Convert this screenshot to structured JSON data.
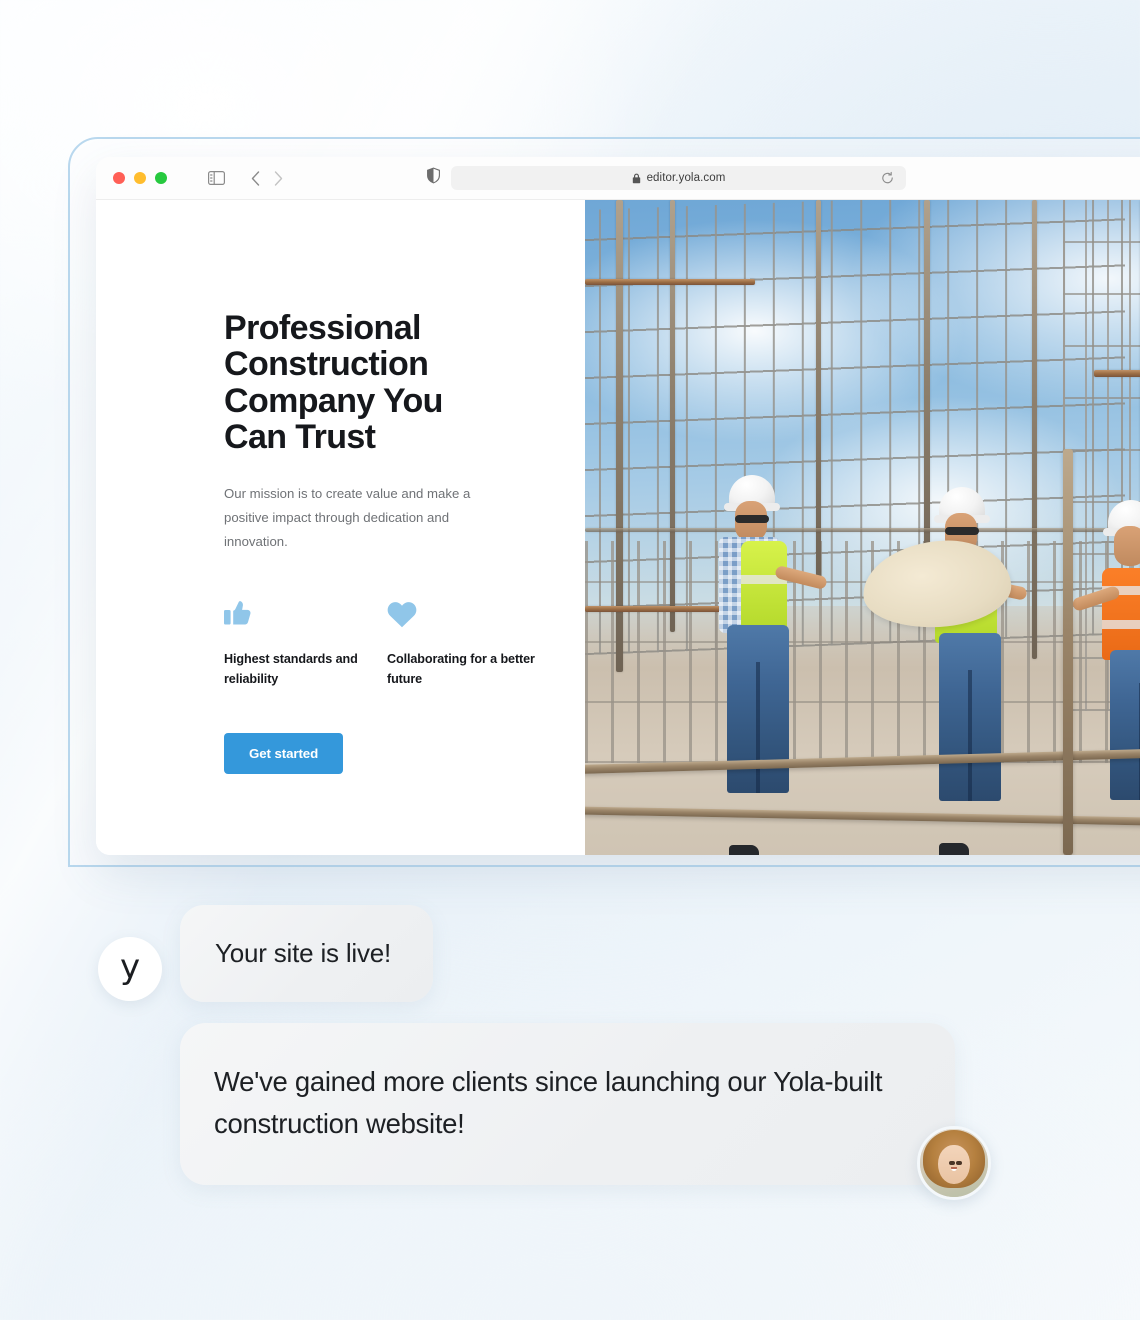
{
  "browser": {
    "traffic_lights": [
      "close",
      "minimize",
      "maximize"
    ],
    "sidebar_icon": "sidebar-toggle-icon",
    "back_icon": "chevron-left-icon",
    "forward_icon": "chevron-right-icon",
    "shield_icon": "privacy-shield-icon",
    "lock_icon": "lock-icon",
    "url": "editor.yola.com",
    "reload_icon": "reload-icon"
  },
  "site": {
    "hero_title": "Professional Construction Company You Can Trust",
    "hero_subtitle": "Our mission is to create value and make a positive impact through dedication and innovation.",
    "features": [
      {
        "icon": "thumbs-up-icon",
        "label": "Highest standards and reliability"
      },
      {
        "icon": "heart-icon",
        "label": "Collaborating for a better future"
      }
    ],
    "cta_label": "Get started",
    "photo_alt": "Three construction workers in hard hats and hi-vis vests reviewing plans at a rebar construction site"
  },
  "chat": {
    "brand_initial": "y",
    "message_1": "Your site is live!",
    "message_2": "We've gained more clients since launching our Yola-built construction website!",
    "avatar_alt": "Smiling woman portrait"
  },
  "colors": {
    "cta_blue": "#3498db",
    "feature_icon_blue": "#90c6e9",
    "frame_border": "#b9d8ee",
    "heading_dark": "#16181c",
    "body_gray": "#6f7276",
    "bubble_gray": "#f1f3f4"
  }
}
